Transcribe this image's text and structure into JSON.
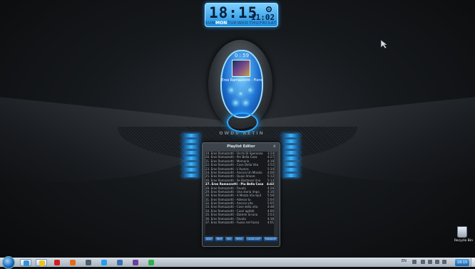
{
  "clock_widget": {
    "time_big": "18:15",
    "time_small": "11:02",
    "days": [
      "SUN",
      "MON",
      "TUE",
      "WED",
      "THU",
      "FRI",
      "SAT"
    ],
    "active_day": "MON"
  },
  "player": {
    "elapsed": "0 : 59",
    "track_info": "Eros Ramazzotti - Fiero",
    "brand": "OWDS AETIN"
  },
  "playlist": {
    "title": "Playlist Editor",
    "close_label": "x",
    "current_index": 8,
    "rows": [
      {
        "title": "19. Eros Ramazzotti - Occhi Di Speranza",
        "time": "3:24"
      },
      {
        "title": "20. Eros Ramazzotti - Per Bella Cosa",
        "time": "4:27"
      },
      {
        "title": "21. Eros Ramazzotti - Memorie",
        "time": "4:19"
      },
      {
        "title": "22. Eros Ramazzotti - Cose Della Vita",
        "time": "3:52"
      },
      {
        "title": "23. Eros Ramazzotti - L'Aurora",
        "time": "5:34"
      },
      {
        "title": "24. Eros Ramazzotti - Ancora Un Minuto",
        "time": "4:06"
      },
      {
        "title": "25. Eros Ramazzotti - Quasi Amore",
        "time": "5:12"
      },
      {
        "title": "26. Eros Ramazzotti - Se Bastasse Una",
        "time": "5:13"
      },
      {
        "title": "27. Eros Ramazzotti - Piu Bella Cosa",
        "time": "4:43"
      },
      {
        "title": "28. Eros Ramazzotti - Favola",
        "time": "4:26"
      },
      {
        "title": "29. Eros Ramazzotti - Una storia impo",
        "time": "4:16"
      },
      {
        "title": "30. Eros Ramazzotti - A Mezza Via.mp3",
        "time": "5:58"
      },
      {
        "title": "31. Eros Ramazzotti - Adesso tu",
        "time": "5:04"
      },
      {
        "title": "32. Eros Ramazzotti - Ancora vita",
        "time": "5:05"
      },
      {
        "title": "33. Eros Ramazzotti - Cose della vita",
        "time": "4:48"
      },
      {
        "title": "34. Eros Ramazzotti - Cuori agitati",
        "time": "4:00"
      },
      {
        "title": "35. Eros Ramazzotti - Dammi la luna",
        "time": "3:53"
      },
      {
        "title": "36. Eros Ramazzotti - Favola",
        "time": "4:38"
      },
      {
        "title": "37. Eros Ramazzotti - Fuoco nel fuoco",
        "time": "4:01"
      }
    ],
    "buttons": [
      "ADD",
      "REM",
      "SEL",
      "MISC",
      "LOAD LIST",
      "MANAGE"
    ]
  },
  "desktop": {
    "recycle_label": "Recycle Bin"
  },
  "taskbar": {
    "language": "EN",
    "clock": "18:15",
    "items": [
      {
        "name": "tb-item-folder",
        "color": "#3b8ed6",
        "active": true
      },
      {
        "name": "tb-item-media",
        "color": "#f0c020",
        "active": true
      },
      {
        "name": "tb-item-opera",
        "color": "#d21f1f",
        "active": false
      },
      {
        "name": "tb-item-firefox",
        "color": "#e36d17",
        "active": false
      },
      {
        "name": "tb-item-app",
        "color": "#4a5c70",
        "active": false
      },
      {
        "name": "tb-item-skype",
        "color": "#1da1f2",
        "active": false
      },
      {
        "name": "tb-item-mail",
        "color": "#3a6fb5",
        "active": false
      },
      {
        "name": "tb-item-player",
        "color": "#6b3fa0",
        "active": false
      },
      {
        "name": "tb-item-messenger",
        "color": "#2bb24c",
        "active": false
      }
    ]
  },
  "colors": {
    "accent": "#2aa8ff",
    "taskbar": "#b9c3cd"
  }
}
